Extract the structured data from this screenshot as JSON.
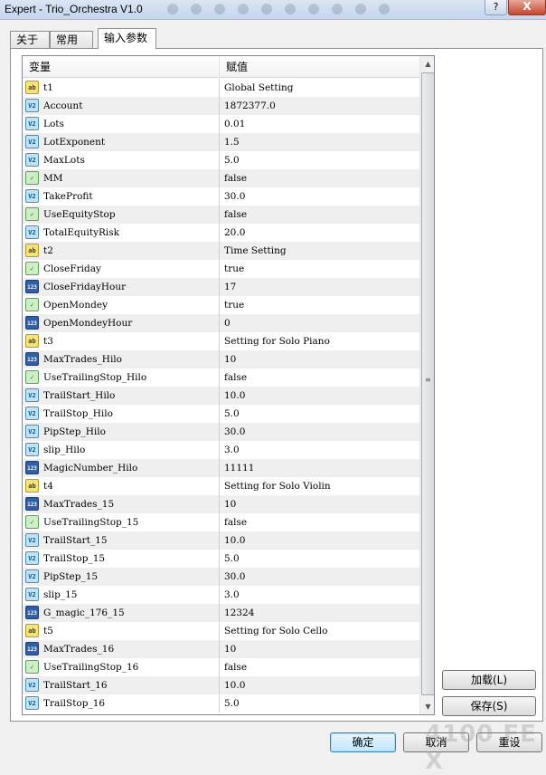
{
  "window": {
    "title": "Expert - Trio_Orchestra V1.0",
    "help_label": "?",
    "close_label": "X"
  },
  "tabs": [
    {
      "label": "关于"
    },
    {
      "label": "常用"
    },
    {
      "label": "输入参数"
    }
  ],
  "grid": {
    "col_variable": "变量",
    "col_value": "赋值",
    "rows": [
      {
        "icon": "ab",
        "name": "t1",
        "value": "Global Setting"
      },
      {
        "icon": "v2",
        "name": "Account",
        "value": "1872377.0"
      },
      {
        "icon": "v2",
        "name": "Lots",
        "value": "0.01"
      },
      {
        "icon": "v2",
        "name": "LotExponent",
        "value": "1.5"
      },
      {
        "icon": "v2",
        "name": "MaxLots",
        "value": "5.0"
      },
      {
        "icon": "bool",
        "name": "MM",
        "value": "false"
      },
      {
        "icon": "v2",
        "name": "TakeProfit",
        "value": "30.0"
      },
      {
        "icon": "bool",
        "name": "UseEquityStop",
        "value": "false"
      },
      {
        "icon": "v2",
        "name": "TotalEquityRisk",
        "value": "20.0"
      },
      {
        "icon": "ab",
        "name": "t2",
        "value": "Time Setting"
      },
      {
        "icon": "bool",
        "name": "CloseFriday",
        "value": "true"
      },
      {
        "icon": "n123",
        "name": "CloseFridayHour",
        "value": "17"
      },
      {
        "icon": "bool",
        "name": "OpenMondey",
        "value": "true"
      },
      {
        "icon": "n123",
        "name": "OpenMondeyHour",
        "value": "0"
      },
      {
        "icon": "ab",
        "name": "t3",
        "value": "Setting for Solo Piano"
      },
      {
        "icon": "n123",
        "name": "MaxTrades_Hilo",
        "value": "10"
      },
      {
        "icon": "bool",
        "name": "UseTrailingStop_Hilo",
        "value": "false"
      },
      {
        "icon": "v2",
        "name": "TrailStart_Hilo",
        "value": "10.0"
      },
      {
        "icon": "v2",
        "name": "TrailStop_Hilo",
        "value": "5.0"
      },
      {
        "icon": "v2",
        "name": "PipStep_Hilo",
        "value": "30.0"
      },
      {
        "icon": "v2",
        "name": "slip_Hilo",
        "value": "3.0"
      },
      {
        "icon": "n123",
        "name": "MagicNumber_Hilo",
        "value": "11111"
      },
      {
        "icon": "ab",
        "name": "t4",
        "value": "Setting for Solo Violin"
      },
      {
        "icon": "n123",
        "name": "MaxTrades_15",
        "value": "10"
      },
      {
        "icon": "bool",
        "name": "UseTrailingStop_15",
        "value": "false"
      },
      {
        "icon": "v2",
        "name": "TrailStart_15",
        "value": "10.0"
      },
      {
        "icon": "v2",
        "name": "TrailStop_15",
        "value": "5.0"
      },
      {
        "icon": "v2",
        "name": "PipStep_15",
        "value": "30.0"
      },
      {
        "icon": "v2",
        "name": "slip_15",
        "value": "3.0"
      },
      {
        "icon": "n123",
        "name": "G_magic_176_15",
        "value": "12324"
      },
      {
        "icon": "ab",
        "name": "t5",
        "value": "Setting for Solo Cello"
      },
      {
        "icon": "n123",
        "name": "MaxTrades_16",
        "value": "10"
      },
      {
        "icon": "bool",
        "name": "UseTrailingStop_16",
        "value": "false"
      },
      {
        "icon": "v2",
        "name": "TrailStart_16",
        "value": "10.0"
      },
      {
        "icon": "v2",
        "name": "TrailStop_16",
        "value": "5.0"
      }
    ]
  },
  "icons": {
    "ab": {
      "text": "ab",
      "name": "string-type-icon"
    },
    "v2": {
      "text": "V2",
      "name": "double-type-icon"
    },
    "bool": {
      "text": "✓",
      "name": "bool-type-icon"
    },
    "n123": {
      "text": "123",
      "name": "integer-type-icon"
    }
  },
  "buttons": {
    "load": "加载(L)",
    "save": "保存(S)",
    "ok": "确定",
    "cancel": "取消",
    "reset": "重设"
  },
  "watermark": "4100 FE X"
}
